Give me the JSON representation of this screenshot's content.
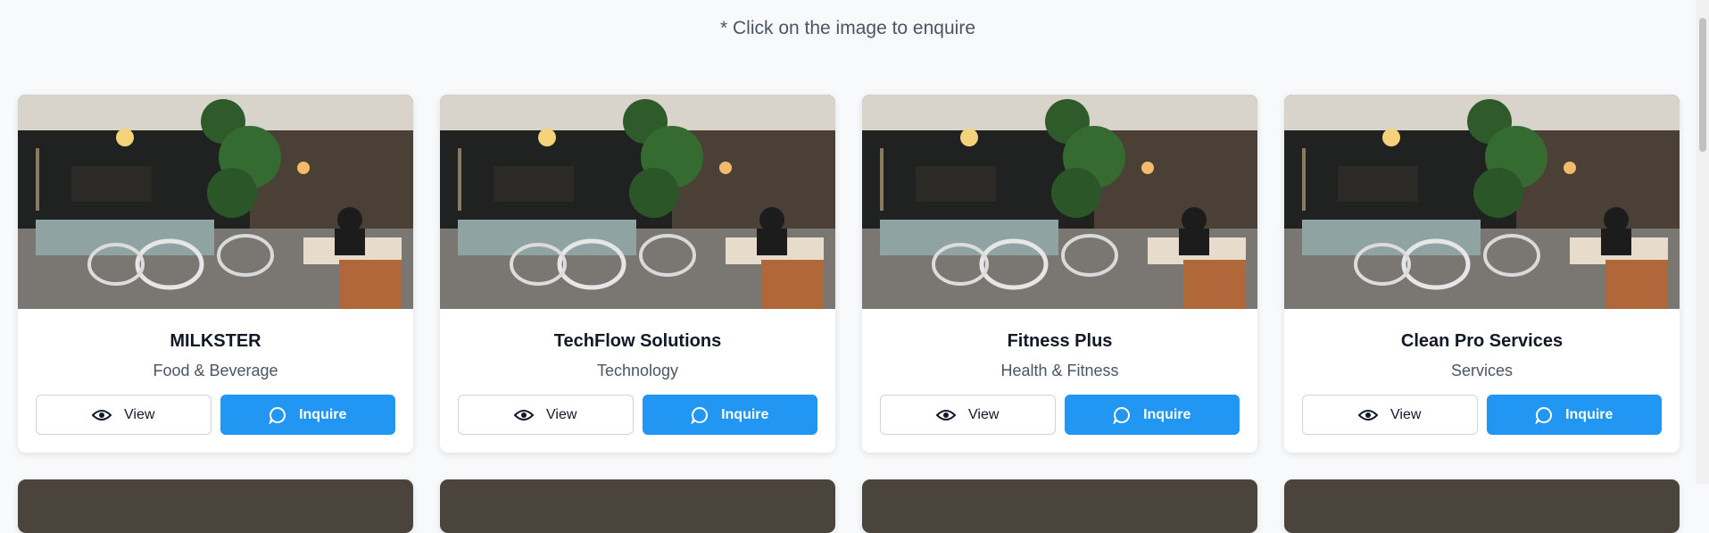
{
  "hint_text": "* Click on the image to enquire",
  "buttons": {
    "view_label": "View",
    "inquire_label": "Inquire"
  },
  "colors": {
    "accent": "#2196f3",
    "background": "#f7f9fb"
  },
  "icons": {
    "view": "eye-icon",
    "inquire": "chat-bubble-icon"
  },
  "listings": [
    {
      "name": "MILKSTER",
      "category": "Food & Beverage"
    },
    {
      "name": "TechFlow Solutions",
      "category": "Technology"
    },
    {
      "name": "Fitness Plus",
      "category": "Health & Fitness"
    },
    {
      "name": "Clean Pro Services",
      "category": "Services"
    }
  ]
}
